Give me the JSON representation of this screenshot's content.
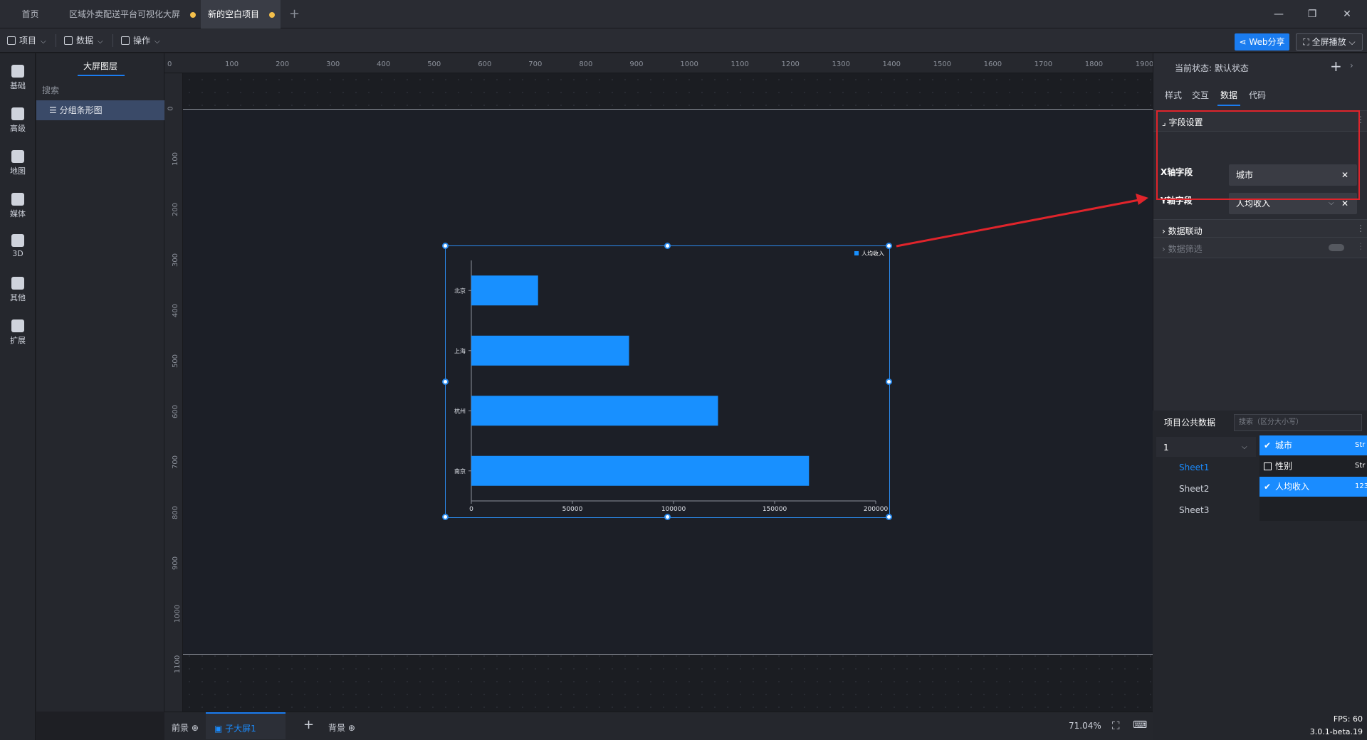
{
  "tabs": [
    {
      "label": "首页"
    },
    {
      "label": "区域外卖配送平台可视化大屏"
    },
    {
      "label": "新的空白项目"
    }
  ],
  "menubar": {
    "project": "项目",
    "data": "数据",
    "operate": "操作",
    "web_share": "Web分享",
    "fullscreen": "全屏播放"
  },
  "categories": [
    "基础",
    "高级",
    "地图",
    "媒体",
    "3D",
    "其他",
    "扩展"
  ],
  "layers": {
    "tab": "大屏图层",
    "search_placeholder": "搜索",
    "items": [
      "分组条形图"
    ]
  },
  "ruler": {
    "h_ticks": [
      "0",
      "100",
      "200",
      "300",
      "400",
      "500",
      "600",
      "700",
      "800",
      "900",
      "1000",
      "1100",
      "1200",
      "1300",
      "1400",
      "1500",
      "1600",
      "1700",
      "1800",
      "1900"
    ],
    "v_ticks": [
      "0",
      "100",
      "200",
      "300",
      "400",
      "500",
      "600",
      "700",
      "800",
      "900",
      "1000",
      "1100"
    ]
  },
  "chart_data": {
    "type": "bar",
    "orientation": "horizontal",
    "categories": [
      "北京",
      "上海",
      "杭州",
      "南京"
    ],
    "series": [
      {
        "name": "人均收入",
        "values": [
          33000,
          78000,
          122000,
          167000
        ],
        "color": "#1890ff"
      }
    ],
    "x_ticks": [
      "0",
      "50000",
      "100000",
      "150000",
      "200000"
    ],
    "xlim": [
      0,
      200000
    ],
    "legend_position": "top-right"
  },
  "bottom": {
    "foreground": "前景",
    "subscreen": "子大屏1",
    "background": "背景",
    "zoom": "71.04%",
    "fps": "FPS: 60",
    "version": "3.0.1-beta.19"
  },
  "right_panel": {
    "state_label": "当前状态:",
    "state_value": "默认状态",
    "tabs": [
      "样式",
      "交互",
      "数据",
      "代码"
    ],
    "field_section": "字段设置",
    "x_label": "X轴字段",
    "x_value": "城市",
    "y_label": "Y轴字段",
    "y_value": "人均收入",
    "linkage": "数据联动",
    "filter": "数据筛选",
    "public_data_title": "项目公共数据",
    "public_data_search": "搜索（区分大小写）",
    "dataset_select": "1",
    "sheets": [
      "Sheet1",
      "Sheet2",
      "Sheet3"
    ],
    "fields": [
      {
        "name": "城市",
        "type": "Str",
        "checked": true
      },
      {
        "name": "性别",
        "type": "Str",
        "checked": false
      },
      {
        "name": "人均收入",
        "type": "123",
        "checked": true
      }
    ]
  },
  "colors": {
    "accent": "#1a7cf0",
    "bar": "#1890ff",
    "highlight_border": "#e0242b"
  }
}
